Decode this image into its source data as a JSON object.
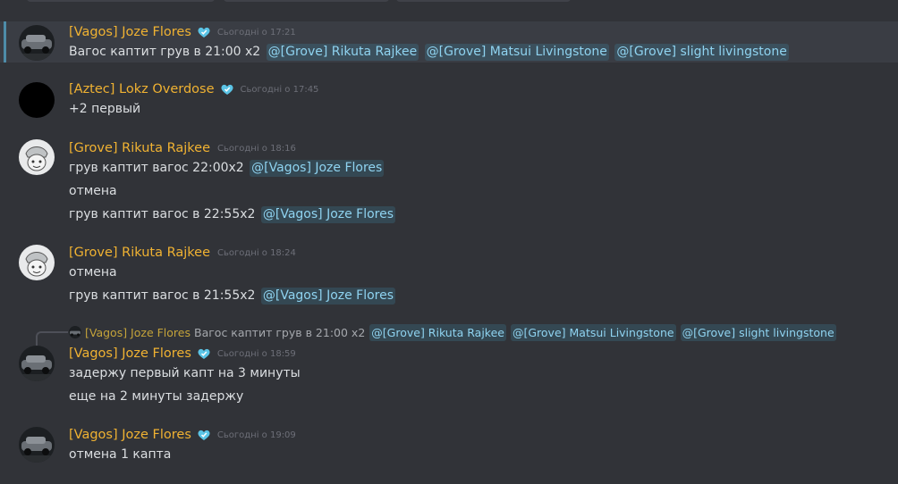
{
  "messages": [
    {
      "author": "[Vagos] Joze Flores",
      "timestamp": "Сьогодні о 17:21",
      "avatar": "car-night-avatar",
      "lines": [
        {
          "text": "Вагос каптит грув в 21:00 x2",
          "mentions": [
            "@[Grove] Rikuta Rajkee",
            "@[Grove] Matsui Livingstone",
            "@[Grove] slight livingstone"
          ]
        }
      ]
    },
    {
      "author": "[Aztec] Lokz Overdose",
      "timestamp": "Сьогодні о 17:45",
      "avatar": "black-circle-avatar",
      "lines": [
        {
          "text": "+2 первый"
        }
      ]
    },
    {
      "author": "[Grove] Rikuta Rajkee",
      "timestamp": "Сьогодні о 18:16",
      "avatar": "sketch-face-avatar",
      "lines": [
        {
          "text": "грув каптит вагос 22:00x2",
          "mentions": [
            "@[Vagos] Joze Flores"
          ]
        },
        {
          "text": "отмена"
        },
        {
          "text": "грув каптит вагос в 22:55x2",
          "mentions": [
            "@[Vagos] Joze Flores"
          ]
        }
      ]
    },
    {
      "author": "[Grove] Rikuta Rajkee",
      "timestamp": "Сьогодні о 18:24",
      "avatar": "sketch-face-avatar",
      "lines": [
        {
          "text": "отмена"
        },
        {
          "text": "грув каптит вагос в 21:55x2",
          "mentions": [
            "@[Vagos] Joze Flores"
          ]
        }
      ]
    },
    {
      "reply": {
        "author": "[Vagos] Joze Flores",
        "text": "Вагос каптит грув в 21:00 x2",
        "mentions": [
          "@[Grove] Rikuta Rajkee",
          "@[Grove] Matsui Livingstone",
          "@[Grove] slight livingstone"
        ]
      },
      "author": "[Vagos] Joze Flores",
      "timestamp": "Сьогодні о 18:59",
      "avatar": "car-night-avatar",
      "lines": [
        {
          "text": "задержу первый капт на 3 минуты"
        },
        {
          "text": "еще на 2 минуты задержу"
        }
      ]
    },
    {
      "author": "[Vagos] Joze Flores",
      "timestamp": "Сьогодні о 19:09",
      "avatar": "car-night-avatar",
      "lines": [
        {
          "text": "отмена 1 капта"
        }
      ]
    }
  ],
  "colors": {
    "background": "#313338",
    "username": "#f0b232",
    "mention_text": "#8fd3f0",
    "badge": "#5bc4e6"
  }
}
